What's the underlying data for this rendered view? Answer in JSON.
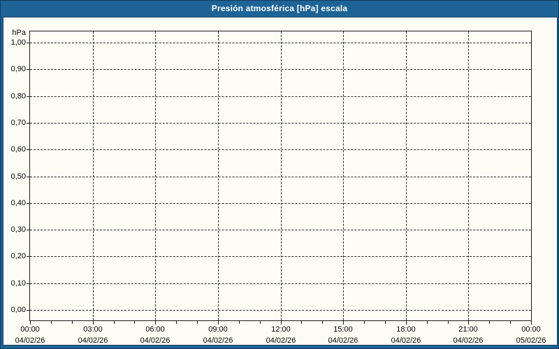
{
  "window": {
    "title": "Presión atmosférica [hPa] escala"
  },
  "colors": {
    "titlebar_bg": "#1d6395",
    "frame_blue": "#1d6395",
    "frame_dark": "#1c3e63",
    "content_bg": "#fdfdf5",
    "grid_line": "#262626",
    "axis_line": "#1a1a1a",
    "title_text": "#ffffff",
    "label_text": "#000000"
  },
  "chart_data": {
    "type": "line",
    "title": "Presión atmosférica [hPa] escala",
    "unit_label": "hPa",
    "ylabel": "hPa",
    "xlabel": "",
    "ylim": [
      0.0,
      1.0
    ],
    "y_tick_step": 0.1,
    "y_tick_labels": [
      "1,00",
      "0,90",
      "0,80",
      "0,70",
      "0,60",
      "0,50",
      "0,40",
      "0,30",
      "0,20",
      "0,10",
      "0,00"
    ],
    "x_hours_range": [
      0,
      24
    ],
    "x_major_tick_hours": 3,
    "x_minor_tick_hours": 1,
    "x_tick_labels": [
      {
        "time": "00:00",
        "date": "04/02/26"
      },
      {
        "time": "03:00",
        "date": "04/02/26"
      },
      {
        "time": "06:00",
        "date": "04/02/26"
      },
      {
        "time": "09:00",
        "date": "04/02/26"
      },
      {
        "time": "12:00",
        "date": "04/02/26"
      },
      {
        "time": "15:00",
        "date": "04/02/26"
      },
      {
        "time": "18:00",
        "date": "04/02/26"
      },
      {
        "time": "21:00",
        "date": "04/02/26"
      },
      {
        "time": "00:00",
        "date": "05/02/26"
      }
    ],
    "grid": "dashed",
    "legend": "none",
    "series": []
  }
}
